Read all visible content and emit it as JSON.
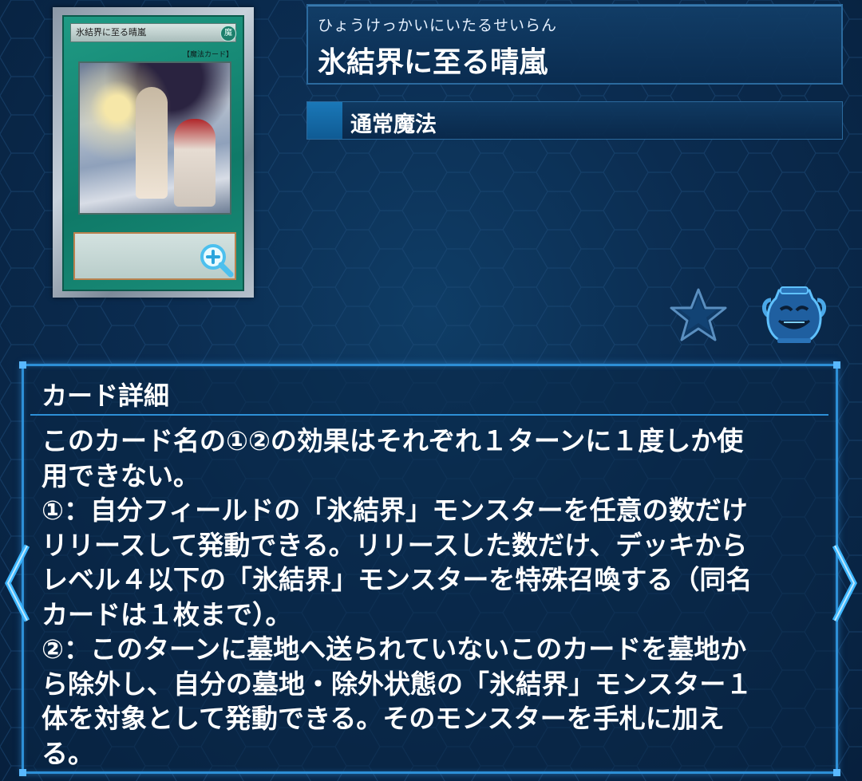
{
  "card": {
    "image_name": "氷結界に至る晴嵐",
    "image_type_line": "【魔法カード】",
    "image_attr": "魔"
  },
  "name_panel": {
    "ruby": "ひょうけっかいにいたるせいらん",
    "title": "氷結界に至る晴嵐"
  },
  "type_panel": {
    "label": "通常魔法",
    "color": "#1a78b8"
  },
  "actions": {
    "favorite_icon": "star-icon",
    "pot_icon": "pot-of-greed-icon"
  },
  "detail": {
    "heading": "カード詳細",
    "text": "このカード名の①②の効果はそれぞれ１ターンに１度しか使\n用できない。\n①：自分フィールドの「氷結界」モンスターを任意の数だけ\nリリースして発動できる。リリースした数だけ、デッキから\nレベル４以下の「氷結界」モンスターを特殊召喚する（同名\nカードは１枚まで）。\n②：このターンに墓地へ送られていないこのカードを墓地か\nら除外し、自分の墓地・除外状態の「氷結界」モンスター１\n体を対象として発動できる。そのモンスターを手札に加え\nる。"
  },
  "colors": {
    "accent": "#2d8fd6",
    "background": "#0b2c50",
    "spell_card": "#1f9a84"
  }
}
